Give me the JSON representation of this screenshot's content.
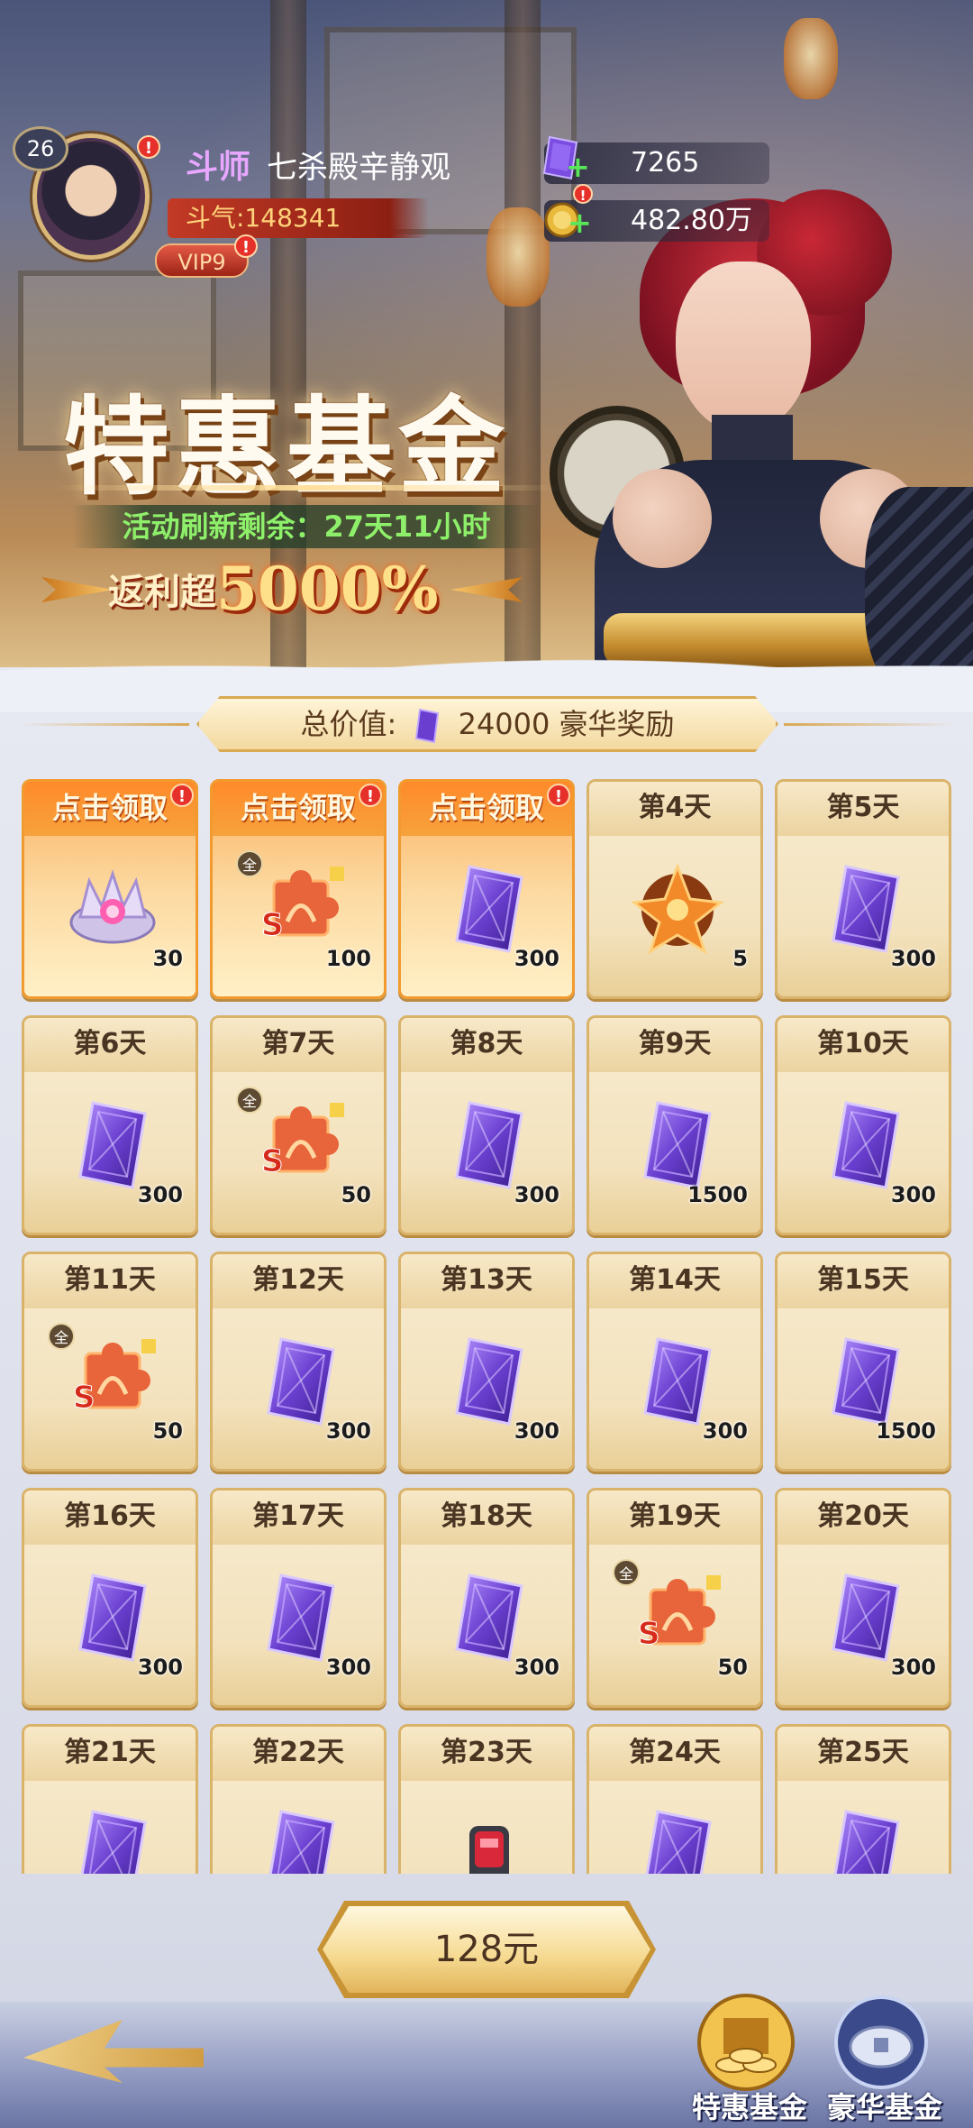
{
  "player": {
    "level": "26",
    "rank": "斗师",
    "name": "七杀殿辛静观",
    "power": "斗气:148341",
    "vip": "VIP9",
    "alert": "!"
  },
  "resources": {
    "gems": "7265",
    "gold": "482.80万"
  },
  "banner": {
    "title": "特惠基金",
    "refresh": "活动刷新剩余：27天11小时",
    "rebate_prefix": "返利超",
    "rebate_value": "5000%"
  },
  "total": {
    "label": "总价值:",
    "value": "24000 豪华奖励"
  },
  "rewards": [
    {
      "label": "点击领取",
      "claim": true,
      "item": "crown",
      "qty": "30"
    },
    {
      "label": "点击领取",
      "claim": true,
      "item": "puzzle",
      "qty": "100",
      "tag": "全"
    },
    {
      "label": "点击领取",
      "claim": true,
      "item": "gem",
      "qty": "300"
    },
    {
      "label": "第4天",
      "claim": false,
      "item": "emblem",
      "qty": "5"
    },
    {
      "label": "第5天",
      "claim": false,
      "item": "gem",
      "qty": "300"
    },
    {
      "label": "第6天",
      "claim": false,
      "item": "gem",
      "qty": "300"
    },
    {
      "label": "第7天",
      "claim": false,
      "item": "puzzle",
      "qty": "50",
      "tag": "全"
    },
    {
      "label": "第8天",
      "claim": false,
      "item": "gem",
      "qty": "300"
    },
    {
      "label": "第9天",
      "claim": false,
      "item": "gem",
      "qty": "1500"
    },
    {
      "label": "第10天",
      "claim": false,
      "item": "gem",
      "qty": "300"
    },
    {
      "label": "第11天",
      "claim": false,
      "item": "puzzle",
      "qty": "50",
      "tag": "全"
    },
    {
      "label": "第12天",
      "claim": false,
      "item": "gem",
      "qty": "300"
    },
    {
      "label": "第13天",
      "claim": false,
      "item": "gem",
      "qty": "300"
    },
    {
      "label": "第14天",
      "claim": false,
      "item": "gem",
      "qty": "300"
    },
    {
      "label": "第15天",
      "claim": false,
      "item": "gem",
      "qty": "1500"
    },
    {
      "label": "第16天",
      "claim": false,
      "item": "gem",
      "qty": "300"
    },
    {
      "label": "第17天",
      "claim": false,
      "item": "gem",
      "qty": "300"
    },
    {
      "label": "第18天",
      "claim": false,
      "item": "gem",
      "qty": "300"
    },
    {
      "label": "第19天",
      "claim": false,
      "item": "puzzle",
      "qty": "50",
      "tag": "全"
    },
    {
      "label": "第20天",
      "claim": false,
      "item": "gem",
      "qty": "300"
    },
    {
      "label": "第21天",
      "claim": false,
      "item": "gem",
      "qty": ""
    },
    {
      "label": "第22天",
      "claim": false,
      "item": "gem",
      "qty": ""
    },
    {
      "label": "第23天",
      "claim": false,
      "item": "gauntlet",
      "qty": ""
    },
    {
      "label": "第24天",
      "claim": false,
      "item": "gem",
      "qty": ""
    },
    {
      "label": "第25天",
      "claim": false,
      "item": "gem",
      "qty": ""
    }
  ],
  "buy_button": "128元",
  "tabs": [
    {
      "label": "特惠基金"
    },
    {
      "label": "豪华基金"
    }
  ],
  "colors": {
    "claim_orange": "#f6a23c",
    "card_gold": "#f3e2bd",
    "gem_purple": "#6a3fd0",
    "alert_red": "#e6302a",
    "refresh_green": "#8ef06a"
  }
}
